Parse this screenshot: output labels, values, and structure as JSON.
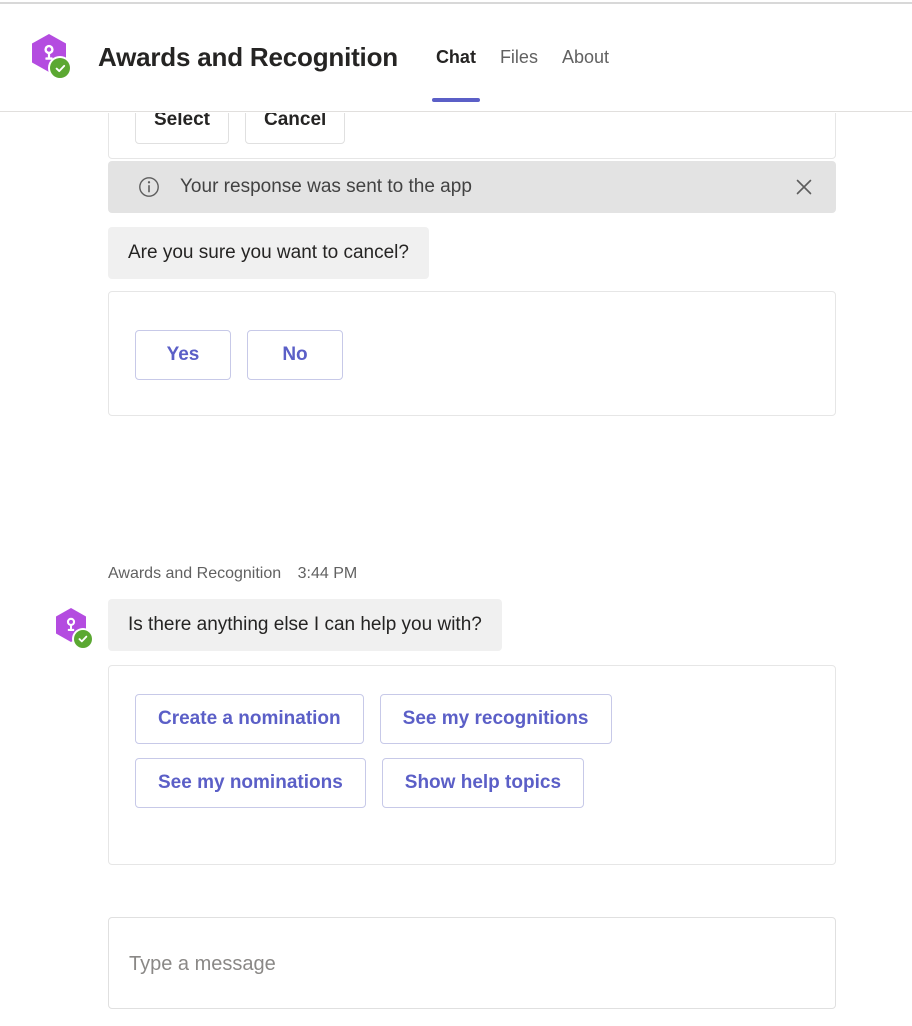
{
  "header": {
    "app_icon": "award-trophy-icon",
    "presence_icon": "available-check-icon",
    "title": "Awards and Recognition",
    "tabs": [
      {
        "label": "Chat",
        "active": true
      },
      {
        "label": "Files",
        "active": false
      },
      {
        "label": "About",
        "active": false
      }
    ],
    "accent_color": "#5b5fc7",
    "icon_color": "#b44ce0",
    "presence_color": "#5ba832"
  },
  "conversation": {
    "clipped_card": {
      "buttons": [
        {
          "label": "Select"
        },
        {
          "label": "Cancel"
        }
      ]
    },
    "notice": {
      "icon": "info-circle-icon",
      "text": "Your response was sent to the app",
      "close_icon": "close-icon"
    },
    "cancel_prompt": {
      "text": "Are you sure you want to cancel?"
    },
    "yes_no_card": {
      "buttons": [
        {
          "label": "Yes"
        },
        {
          "label": "No"
        }
      ]
    },
    "bot_message": {
      "sender": "Awards and Recognition",
      "timestamp": "3:44 PM",
      "text": "Is there anything else I can help you with?",
      "avatar_icon": "award-trophy-icon",
      "presence_icon": "available-check-icon"
    },
    "suggestions_card": {
      "rows": [
        [
          {
            "label": "Create a nomination"
          },
          {
            "label": "See my recognitions"
          }
        ],
        [
          {
            "label": "See my nominations"
          },
          {
            "label": "Show help topics"
          }
        ]
      ]
    }
  },
  "compose": {
    "placeholder": "Type a message",
    "value": ""
  }
}
